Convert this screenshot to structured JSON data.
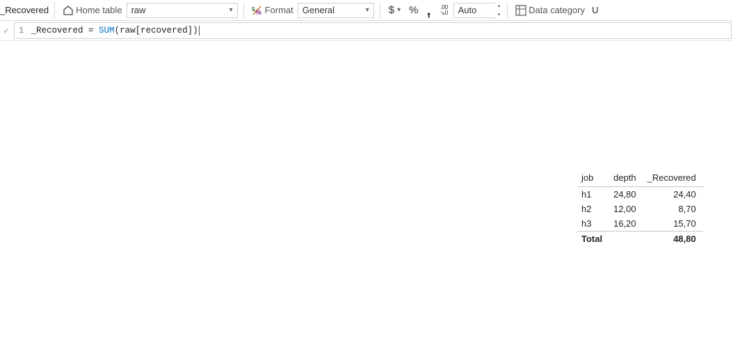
{
  "ribbon": {
    "measure_name": "_Recovered",
    "home_table_label": "Home table",
    "home_table_value": "raw",
    "format_label": "Format",
    "format_value": "General",
    "currency_symbol": "$",
    "percent_symbol": "%",
    "thousands_symbol": ",",
    "digits_icon_top": ".00",
    "digits_icon_bottom": "↘0",
    "decimals_value": "Auto",
    "data_category_label": "Data category",
    "right_cut_letter": "U"
  },
  "formula": {
    "line_no": "1",
    "measure": "_Recovered",
    "equals": " = ",
    "func": "SUM",
    "open": "(",
    "args": "raw[recovered]",
    "close": ")"
  },
  "table": {
    "columns": [
      "job",
      "depth",
      "_Recovered"
    ],
    "rows": [
      {
        "job": "h1",
        "depth": "24,80",
        "value": "24,40"
      },
      {
        "job": "h2",
        "depth": "12,00",
        "value": "8,70"
      },
      {
        "job": "h3",
        "depth": "16,20",
        "value": "15,70"
      }
    ],
    "total_label": "Total",
    "total_value": "48,80"
  }
}
